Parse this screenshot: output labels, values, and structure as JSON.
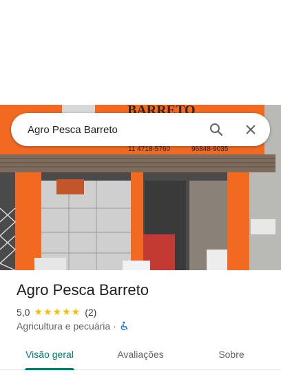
{
  "search": {
    "query": "Agro Pesca Barreto"
  },
  "storefront": {
    "sign_text": "BARRETO",
    "phone_left": "11 4718-5760",
    "phone_right": "96848-9035"
  },
  "place": {
    "name": "Agro Pesca Barreto",
    "rating": "5,0",
    "stars": "★★★★★",
    "review_count": "(2)",
    "category": "Agricultura e pecuária",
    "separator": "·"
  },
  "tabs": [
    {
      "label": "Visão geral"
    },
    {
      "label": "Avaliações"
    },
    {
      "label": "Sobre"
    }
  ],
  "colors": {
    "accent": "#00796b",
    "star": "#fbbc04",
    "storefront_orange": "#f36c21"
  }
}
